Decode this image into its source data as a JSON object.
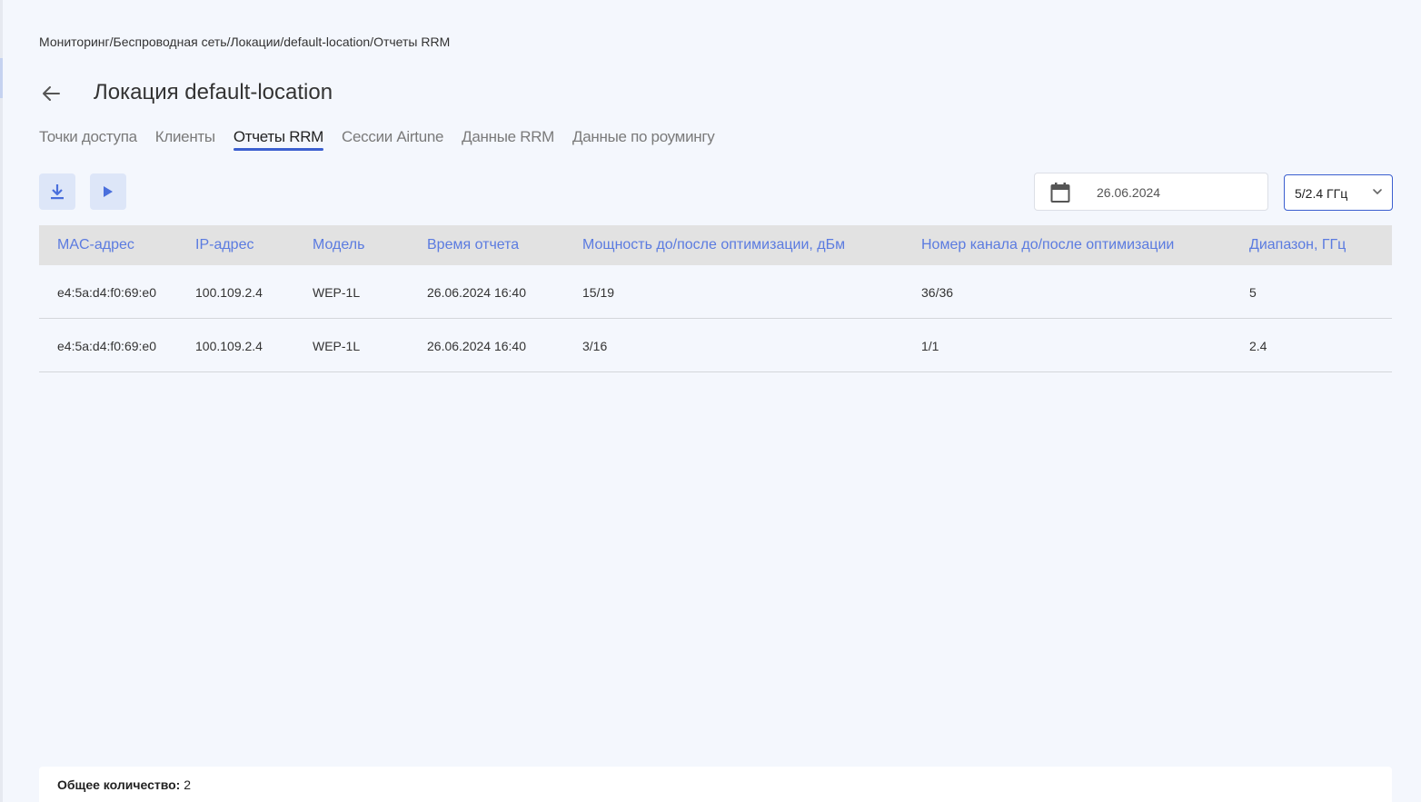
{
  "breadcrumb": "Мониторинг/Беспроводная сеть/Локации/default-location/Отчеты RRM",
  "page_title": "Локация default-location",
  "tabs": [
    {
      "label": "Точки доступа"
    },
    {
      "label": "Клиенты"
    },
    {
      "label": "Отчеты RRM",
      "active": true
    },
    {
      "label": "Сессии Airtune"
    },
    {
      "label": "Данные RRM"
    },
    {
      "label": "Данные по роумингу"
    }
  ],
  "toolbar": {
    "download_icon": "download-icon",
    "play_icon": "play-icon"
  },
  "date_filter": {
    "value": "26.06.2024",
    "icon": "calendar-icon"
  },
  "band_select": {
    "value": "5/2.4 ГГц",
    "icon": "chevron-down-icon"
  },
  "table": {
    "columns": [
      "MAC-адрес",
      "IP-адрес",
      "Модель",
      "Время отчета",
      "Мощность до/после оптимизации, дБм",
      "Номер канала до/после оптимизации",
      "Диапазон, ГГц"
    ],
    "rows": [
      [
        "e4:5a:d4:f0:69:e0",
        "100.109.2.4",
        "WEP-1L",
        "26.06.2024 16:40",
        "15/19",
        "36/36",
        "5"
      ],
      [
        "e4:5a:d4:f0:69:e0",
        "100.109.2.4",
        "WEP-1L",
        "26.06.2024 16:40",
        "3/16",
        "1/1",
        "2.4"
      ]
    ]
  },
  "footer": {
    "total_label": "Общее количество:",
    "total_value": "2"
  },
  "colors": {
    "accent": "#3b5fcf",
    "header_text": "#5b7be0",
    "background": "#f4f7fd"
  }
}
